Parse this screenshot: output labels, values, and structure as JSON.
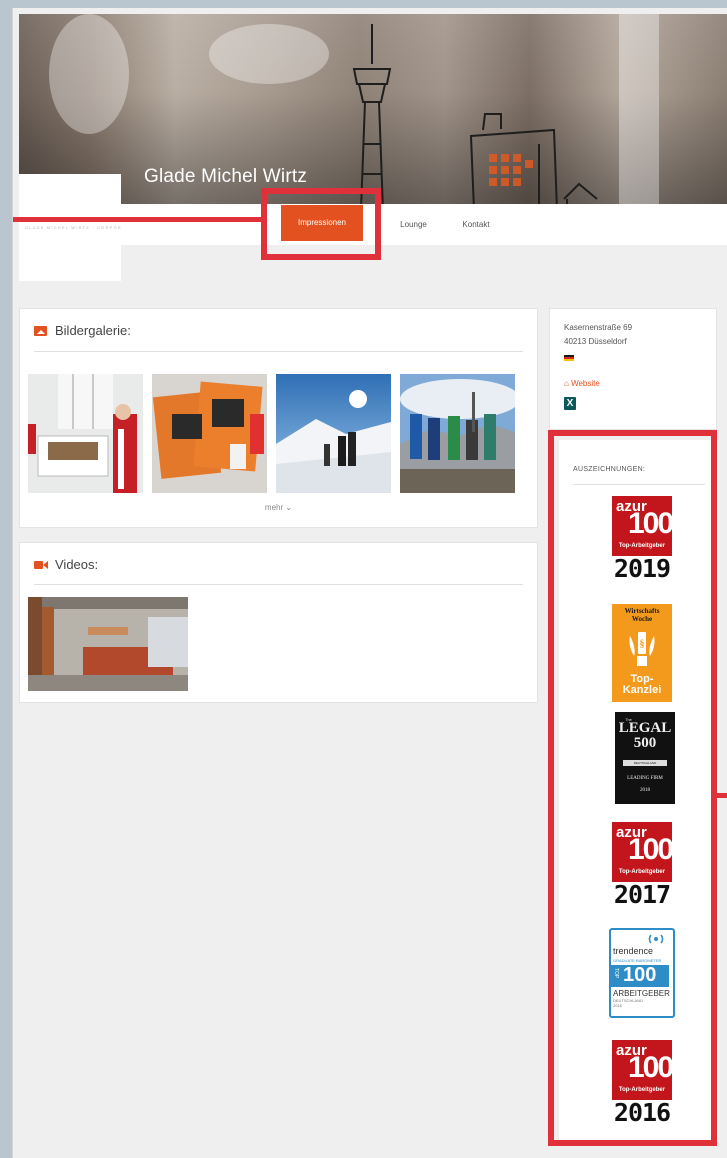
{
  "header": {
    "company_name": "Glade Michel Wirtz"
  },
  "logo": {
    "tagline": "GLADE MICHEL WIRTZ · CORPORATE & COMPETITION"
  },
  "nav": {
    "items": [
      "Impressionen",
      "Lounge",
      "Kontakt"
    ],
    "active": "Impressionen"
  },
  "gallery": {
    "title": "Bildergalerie:",
    "more_label": "mehr ⌄"
  },
  "videos": {
    "title": "Videos:"
  },
  "contact": {
    "street": "Kasernenstraße 69",
    "city": "40213 Düsseldorf",
    "website_label": "Website",
    "xing_label": "X"
  },
  "awards": {
    "title": "AUSZEICHNUNGEN:",
    "azur_word": "azur",
    "azur_number": "100",
    "azur_sub": "Top-Arbeitgeber",
    "azur_years": [
      "2019",
      "2017",
      "2016"
    ],
    "ww_title_1": "Wirtschafts",
    "ww_title_2": "Woche",
    "ww_sub_1": "Top-",
    "ww_sub_2": "Kanzlei",
    "legal_the": "The",
    "legal_name_1": "LEGAL",
    "legal_name_2": "500",
    "legal_country": "DEUTSCHLAND",
    "legal_leading": "LEADING FIRM",
    "legal_year": "2018",
    "trendence_name": "trendence",
    "trendence_gb": "GRADUATE BAROMETER",
    "trendence_top": "TOP",
    "trendence_100": "100",
    "trendence_ag": "ARBEITGEBER",
    "trendence_de_1": "DEUTSCHLAND",
    "trendence_de_2": "2016"
  },
  "colors": {
    "accent": "#e2511f",
    "annotation": "#e0303a"
  }
}
